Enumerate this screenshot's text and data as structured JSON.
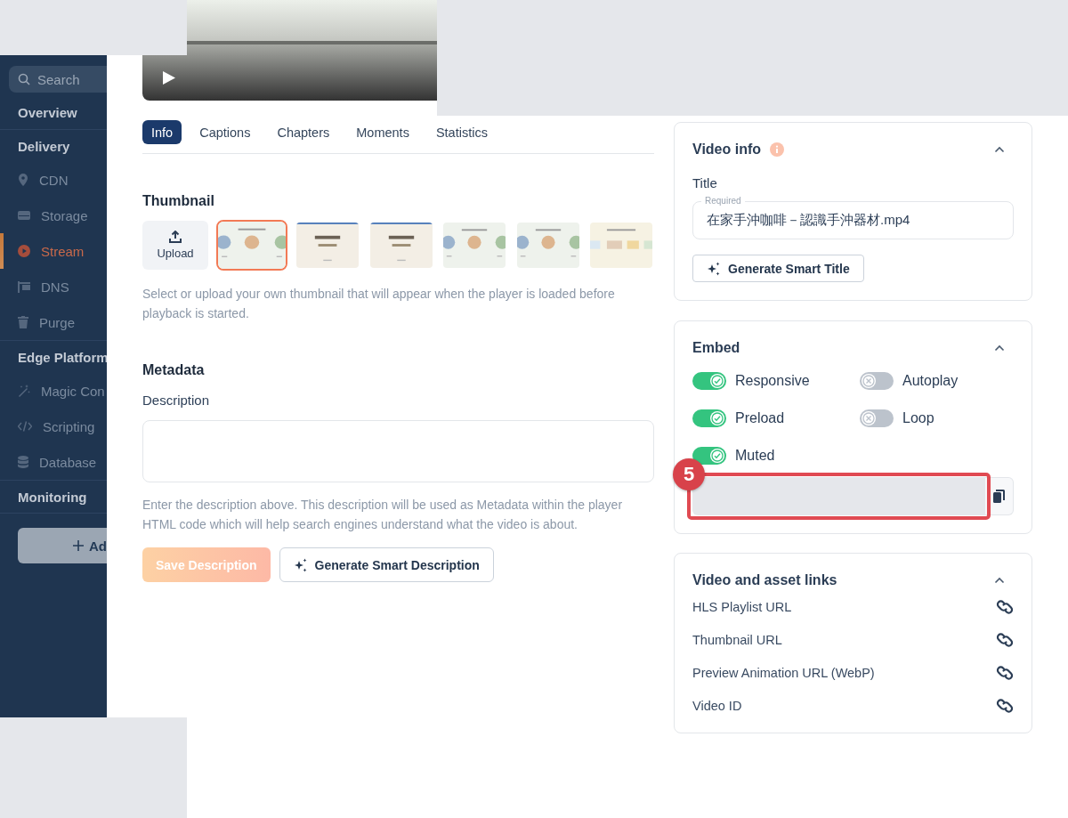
{
  "sidebar": {
    "search": {
      "placeholder": "Search"
    },
    "items": [
      {
        "label": "Overview",
        "kind": "section",
        "selected": false
      },
      {
        "label": "Delivery",
        "kind": "section",
        "selected": false
      },
      {
        "label": "CDN",
        "kind": "item",
        "selected": false
      },
      {
        "label": "Storage",
        "kind": "item",
        "selected": false
      },
      {
        "label": "Stream",
        "kind": "item",
        "selected": true
      },
      {
        "label": "DNS",
        "kind": "item",
        "selected": false
      },
      {
        "label": "Purge",
        "kind": "item",
        "selected": false
      },
      {
        "label": "Edge Platform",
        "kind": "section",
        "selected": false
      },
      {
        "label": "Magic Con",
        "kind": "item",
        "selected": false
      },
      {
        "label": "Scripting",
        "kind": "item",
        "selected": false
      },
      {
        "label": "Database",
        "kind": "item",
        "selected": false
      },
      {
        "label": "Monitoring",
        "kind": "section",
        "selected": false
      }
    ],
    "add_button": {
      "label": "Ad"
    }
  },
  "tabs": [
    {
      "label": "Info",
      "selected": true
    },
    {
      "label": "Captions",
      "selected": false
    },
    {
      "label": "Chapters",
      "selected": false
    },
    {
      "label": "Moments",
      "selected": false
    },
    {
      "label": "Statistics",
      "selected": false
    }
  ],
  "thumbnail": {
    "heading": "Thumbnail",
    "upload_label": "Upload",
    "options": [
      {
        "kind": "picture",
        "selected": true
      },
      {
        "kind": "picture",
        "selected": false
      },
      {
        "kind": "picture",
        "selected": false
      },
      {
        "kind": "picture",
        "selected": false
      },
      {
        "kind": "picture",
        "selected": false
      },
      {
        "kind": "picture",
        "selected": false
      }
    ],
    "help": "Select or upload your own thumbnail that will appear when the player is loaded before playback is started."
  },
  "metadata": {
    "heading": "Metadata",
    "description_label": "Description",
    "help": "Enter the description above. This description will be used as Metadata within the player HTML code which will help search engines understand what the video is about.",
    "save_button": {
      "label": "Save Description",
      "disabled": true
    },
    "generate_button": "Generate Smart Description"
  },
  "video_info": {
    "title": "Video info",
    "expanded": true,
    "title_label": "Title",
    "title_field": {
      "floating_label": "Required",
      "value": "在家手沖咖啡－認識手沖器材.mp4"
    },
    "generate_button": "Generate Smart Title"
  },
  "embed": {
    "title": "Embed",
    "expanded": true,
    "toggles": [
      {
        "label": "Responsive",
        "on": true
      },
      {
        "label": "Autoplay",
        "on": false
      },
      {
        "label": "Preload",
        "on": true
      },
      {
        "label": "Loop",
        "on": false
      },
      {
        "label": "Muted",
        "on": true
      }
    ],
    "annotation": {
      "number": "5"
    }
  },
  "asset_links": {
    "title": "Video and asset links",
    "expanded": true,
    "links": [
      {
        "label": "HLS Playlist URL"
      },
      {
        "label": "Thumbnail URL"
      },
      {
        "label": "Preview Animation URL (WebP)"
      },
      {
        "label": "Video ID"
      }
    ]
  }
}
